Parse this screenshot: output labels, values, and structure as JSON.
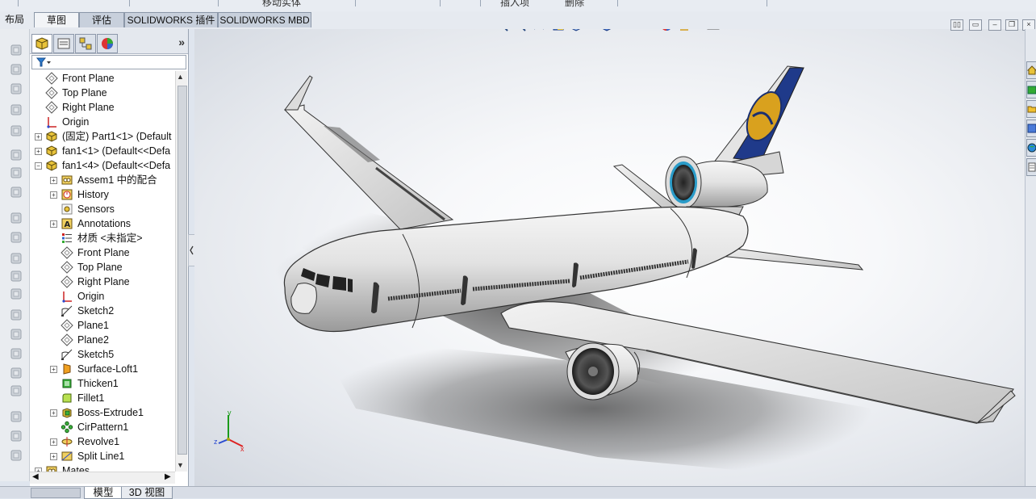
{
  "window": {
    "top_tabs": [
      "布局",
      "草图",
      "评估",
      "SOLIDWORKS 插件",
      "SOLIDWORKS MBD"
    ],
    "top_truncated_labels": [
      "移动实体",
      "插入项",
      "删除"
    ],
    "colors": {
      "accent": "#2a5bb6",
      "panel_bg": "#ffffff",
      "tab_bg": "#c8d0dc"
    }
  },
  "feature_manager": {
    "panel_tabs": [
      "feature-manager-tab",
      "property-manager-tab",
      "configuration-manager-tab",
      "display-manager-tab"
    ],
    "expand_label": "»",
    "tree": [
      {
        "label": "Front Plane",
        "icon": "plane-icon",
        "indent": 0,
        "toggle": ""
      },
      {
        "label": "Top Plane",
        "icon": "plane-icon",
        "indent": 0,
        "toggle": ""
      },
      {
        "label": "Right Plane",
        "icon": "plane-icon",
        "indent": 0,
        "toggle": ""
      },
      {
        "label": "Origin",
        "icon": "origin-icon",
        "indent": 0,
        "toggle": ""
      },
      {
        "label": "(固定) Part1<1> (Default",
        "icon": "part-icon",
        "indent": 0,
        "toggle": "+"
      },
      {
        "label": "fan1<1> (Default<<Defa",
        "icon": "part-icon",
        "indent": 0,
        "toggle": "+"
      },
      {
        "label": "fan1<4> (Default<<Defa",
        "icon": "part-icon",
        "indent": 0,
        "toggle": "−"
      },
      {
        "label": "Assem1 中的配合",
        "icon": "mates-icon",
        "indent": 1,
        "toggle": "+"
      },
      {
        "label": "History",
        "icon": "history-icon",
        "indent": 1,
        "toggle": "+"
      },
      {
        "label": "Sensors",
        "icon": "sensor-icon",
        "indent": 1,
        "toggle": ""
      },
      {
        "label": "Annotations",
        "icon": "annotation-icon",
        "indent": 1,
        "toggle": "+"
      },
      {
        "label": "材质 <未指定>",
        "icon": "material-icon",
        "indent": 1,
        "toggle": ""
      },
      {
        "label": "Front Plane",
        "icon": "plane-icon",
        "indent": 1,
        "toggle": ""
      },
      {
        "label": "Top Plane",
        "icon": "plane-icon",
        "indent": 1,
        "toggle": ""
      },
      {
        "label": "Right Plane",
        "icon": "plane-icon",
        "indent": 1,
        "toggle": ""
      },
      {
        "label": "Origin",
        "icon": "origin-icon",
        "indent": 1,
        "toggle": ""
      },
      {
        "label": "Sketch2",
        "icon": "sketch-icon",
        "indent": 1,
        "toggle": ""
      },
      {
        "label": "Plane1",
        "icon": "plane-icon",
        "indent": 1,
        "toggle": ""
      },
      {
        "label": "Plane2",
        "icon": "plane-icon",
        "indent": 1,
        "toggle": ""
      },
      {
        "label": "Sketch5",
        "icon": "sketch-icon",
        "indent": 1,
        "toggle": ""
      },
      {
        "label": "Surface-Loft1",
        "icon": "surface-loft-icon",
        "indent": 1,
        "toggle": "+"
      },
      {
        "label": "Thicken1",
        "icon": "thicken-icon",
        "indent": 1,
        "toggle": ""
      },
      {
        "label": "Fillet1",
        "icon": "fillet-icon",
        "indent": 1,
        "toggle": ""
      },
      {
        "label": "Boss-Extrude1",
        "icon": "extrude-icon",
        "indent": 1,
        "toggle": "+"
      },
      {
        "label": "CirPattern1",
        "icon": "pattern-icon",
        "indent": 1,
        "toggle": ""
      },
      {
        "label": "Revolve1",
        "icon": "revolve-icon",
        "indent": 1,
        "toggle": "+"
      },
      {
        "label": "Split Line1",
        "icon": "split-line-icon",
        "indent": 1,
        "toggle": "+"
      },
      {
        "label": "Mates",
        "icon": "mates-icon",
        "indent": 0,
        "toggle": "+"
      }
    ]
  },
  "bottom_tabs": [
    "模型",
    "3D 视图"
  ],
  "triad": {
    "x": "x",
    "y": "y",
    "z": "z"
  }
}
